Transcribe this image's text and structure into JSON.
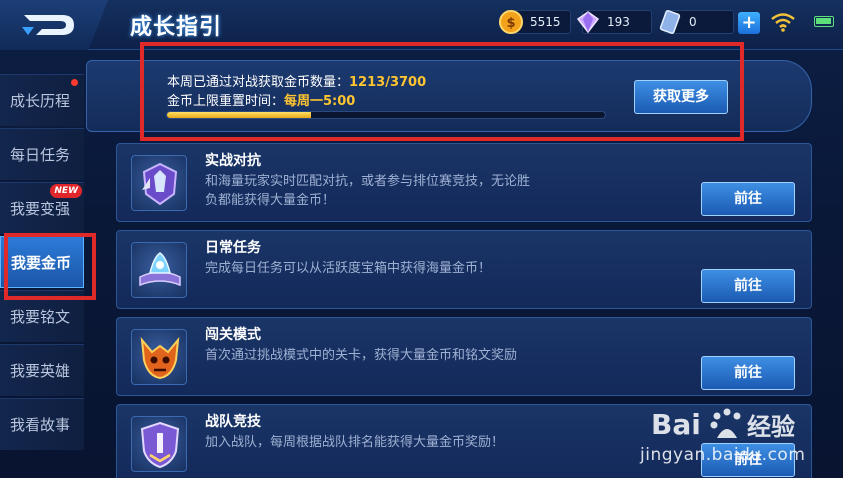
{
  "header": {
    "title": "成长指引",
    "gold": "5515",
    "gems": "193",
    "cards": "0",
    "icons": [
      "back-icon",
      "gold-coin-icon",
      "diamond-icon",
      "voucher-icon",
      "plus-icon",
      "wifi-icon",
      "battery-icon"
    ]
  },
  "sidebar": {
    "items": [
      {
        "label": "成长历程",
        "badge": "red-dot"
      },
      {
        "label": "每日任务"
      },
      {
        "label": "我要变强",
        "badge": "NEW"
      },
      {
        "label": "我要金币",
        "active": true
      },
      {
        "label": "我要铭文"
      },
      {
        "label": "我要英雄"
      },
      {
        "label": "我看故事"
      }
    ],
    "new_badge": "NEW"
  },
  "info": {
    "weekly_label": "本周已通过对战获取金币数量：",
    "weekly_value": "1213/3700",
    "reset_label": "金币上限重置时间：",
    "reset_value": "每周一5:00",
    "progress": 0.3278,
    "more_button": "获取更多"
  },
  "tasks": [
    {
      "name": "实战对抗",
      "desc": "和海量玩家实时匹配对抗，或者参与排位赛竞技，无论胜负都能获得大量金币！",
      "button": "前往",
      "icon": "battle-emblem-icon"
    },
    {
      "name": "日常任务",
      "desc": "完成每日任务可以从活跃度宝箱中获得海量金币！",
      "button": "前往",
      "icon": "daily-task-book-icon"
    },
    {
      "name": "闯关模式",
      "desc": "首次通过挑战模式中的关卡，获得大量金币和铭文奖励",
      "button": "前往",
      "icon": "demon-skull-icon"
    },
    {
      "name": "战队竞技",
      "desc": "加入战队，每周根据战队排名能获得大量金币奖励！",
      "button": "前往",
      "icon": "team-shield-icon"
    }
  ],
  "watermark": {
    "logo": "Baidu经验",
    "url": "jingyan.baidu.com"
  },
  "colors": {
    "accent_gold": "#ffc531",
    "button_blue": "#2a74cf",
    "highlight_red": "#e02a2a"
  }
}
